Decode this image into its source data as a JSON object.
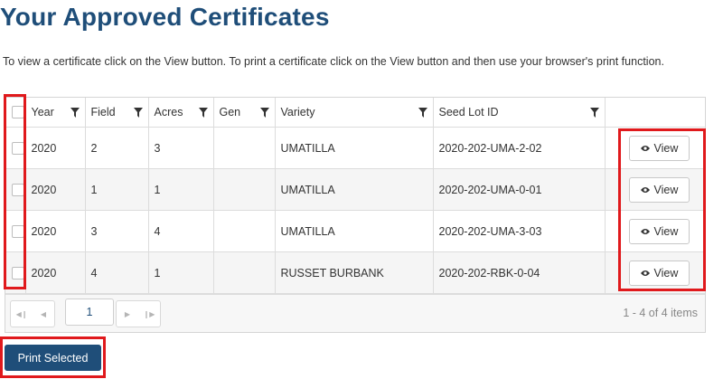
{
  "page": {
    "title": "Your Approved Certificates",
    "instructions": "To view a certificate click on the View button. To print a certificate click on the View button and then use your browser's print function."
  },
  "table": {
    "columns": [
      "Year",
      "Field",
      "Acres",
      "Gen",
      "Variety",
      "Seed Lot ID"
    ],
    "rows": [
      {
        "year": "2020",
        "field": "2",
        "acres": "3",
        "gen": "",
        "variety": "UMATILLA",
        "seed_lot_id": "2020-202-UMA-2-02",
        "action": "View"
      },
      {
        "year": "2020",
        "field": "1",
        "acres": "1",
        "gen": "",
        "variety": "UMATILLA",
        "seed_lot_id": "2020-202-UMA-0-01",
        "action": "View"
      },
      {
        "year": "2020",
        "field": "3",
        "acres": "4",
        "gen": "",
        "variety": "UMATILLA",
        "seed_lot_id": "2020-202-UMA-3-03",
        "action": "View"
      },
      {
        "year": "2020",
        "field": "4",
        "acres": "1",
        "gen": "",
        "variety": "RUSSET BURBANK",
        "seed_lot_id": "2020-202-RBK-0-04",
        "action": "View"
      }
    ]
  },
  "pager": {
    "current_page": "1",
    "info": "1 - 4 of 4 items"
  },
  "print_button": "Print Selected",
  "colors": {
    "title": "#1f4e79",
    "primary_button": "#1f4e79",
    "highlight": "#e0191c"
  },
  "icons": {
    "filter": "filter-icon",
    "eye": "eye-icon",
    "pager_first": "first-page-icon",
    "pager_prev": "prev-page-icon",
    "pager_next": "next-page-icon",
    "pager_last": "last-page-icon"
  }
}
